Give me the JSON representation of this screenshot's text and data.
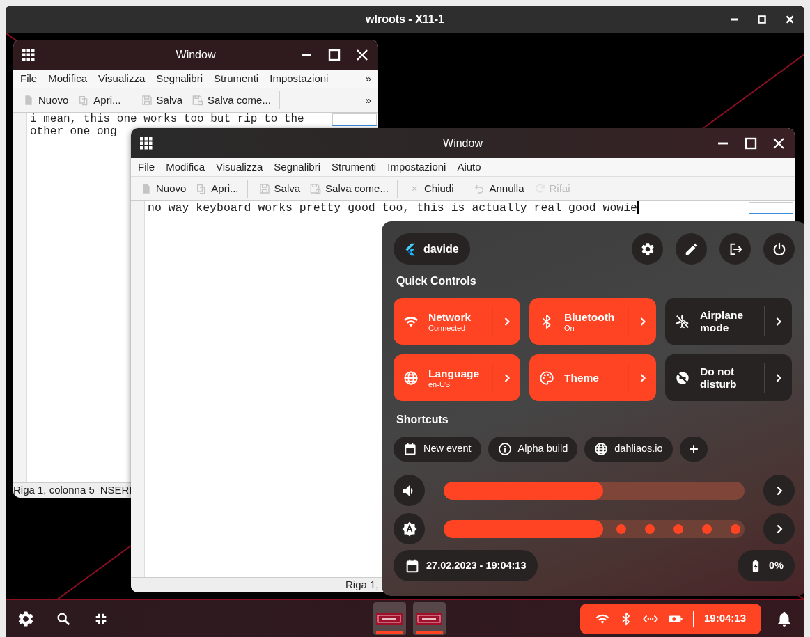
{
  "host_window": {
    "title": "wlroots - X11-1"
  },
  "windows": [
    {
      "title": "Window",
      "focused": false,
      "menu": [
        "File",
        "Modifica",
        "Visualizza",
        "Segnalibri",
        "Strumenti",
        "Impostazioni"
      ],
      "menu_overflow": "»",
      "toolbar": [
        {
          "label": "Nuovo",
          "disabled": false,
          "separator": false
        },
        {
          "label": "Apri...",
          "disabled": false,
          "separator": true
        },
        {
          "label": "Salva",
          "disabled": false,
          "separator": false
        },
        {
          "label": "Salva come...",
          "disabled": false,
          "separator": true
        }
      ],
      "toolbar_overflow": "»",
      "text_lines": [
        "i mean, this one works too but rip to the",
        "other one ong"
      ],
      "status": [
        "Riga 1, colonna 5",
        "NSERI"
      ]
    },
    {
      "title": "Window",
      "focused": true,
      "menu": [
        "File",
        "Modifica",
        "Visualizza",
        "Segnalibri",
        "Strumenti",
        "Impostazioni",
        "Aiuto"
      ],
      "toolbar": [
        {
          "label": "Nuovo",
          "disabled": false,
          "separator": false
        },
        {
          "label": "Apri...",
          "disabled": false,
          "separator": true
        },
        {
          "label": "Salva",
          "disabled": false,
          "separator": false
        },
        {
          "label": "Salva come...",
          "disabled": false,
          "separator": true
        },
        {
          "label": "Chiudi",
          "disabled": false,
          "separator": true
        },
        {
          "label": "Annulla",
          "disabled": false,
          "separator": false
        },
        {
          "label": "Rifai",
          "disabled": true,
          "separator": false
        }
      ],
      "text_lines": [
        "no way keyboard works pretty good too, this is actually real good wowie"
      ],
      "status": [
        "Riga 1,"
      ]
    }
  ],
  "quick_panel": {
    "user": "davide",
    "quick_controls_title": "Quick Controls",
    "tiles": [
      {
        "title": "Network",
        "subtitle": "Connected",
        "on": true
      },
      {
        "title": "Bluetooth",
        "subtitle": "On",
        "on": true
      },
      {
        "title": "Airplane mode",
        "on": false
      },
      {
        "title": "Language",
        "subtitle": "en-US",
        "on": true
      },
      {
        "title": "Theme",
        "on": true
      },
      {
        "title": "Do not disturb",
        "on": false
      }
    ],
    "shortcuts_title": "Shortcuts",
    "shortcuts": [
      "New event",
      "Alpha build",
      "dahliaos.io"
    ],
    "sliders": [
      {
        "kind": "plain",
        "level": 0.53
      },
      {
        "kind": "stepped",
        "level": 0.53
      }
    ],
    "date": "27.02.2023 - 19:04:13",
    "battery": "0%"
  },
  "taskbar": {
    "apps": [
      {
        "active": true
      },
      {
        "active": true
      }
    ],
    "clock": "19:04:13"
  }
}
